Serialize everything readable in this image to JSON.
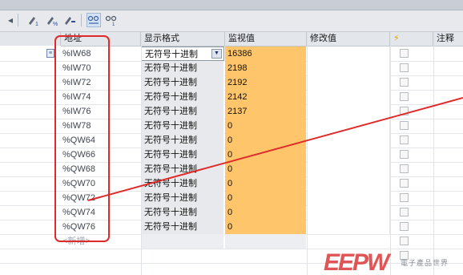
{
  "table": {
    "headers": [
      "地址",
      "显示格式",
      "监视值",
      "修改值",
      "注释"
    ],
    "rows": [
      {
        "address": "%IW68",
        "format": "无符号十进制",
        "monitor": "16386",
        "selected": true
      },
      {
        "address": "%IW70",
        "format": "无符号十进制",
        "monitor": "2198"
      },
      {
        "address": "%IW72",
        "format": "无符号十进制",
        "monitor": "2192"
      },
      {
        "address": "%IW74",
        "format": "无符号十进制",
        "monitor": "2142"
      },
      {
        "address": "%IW76",
        "format": "无符号十进制",
        "monitor": "2137"
      },
      {
        "address": "%IW78",
        "format": "无符号十进制",
        "monitor": "0"
      },
      {
        "address": "%QW64",
        "format": "无符号十进制",
        "monitor": "0"
      },
      {
        "address": "%QW66",
        "format": "无符号十进制",
        "monitor": "0"
      },
      {
        "address": "%QW68",
        "format": "无符号十进制",
        "monitor": "0"
      },
      {
        "address": "%QW70",
        "format": "无符号十进制",
        "monitor": "0"
      },
      {
        "address": "%QW72",
        "format": "无符号十进制",
        "monitor": "0"
      },
      {
        "address": "%QW74",
        "format": "无符号十进制",
        "monitor": "0"
      },
      {
        "address": "%QW76",
        "format": "无符号十进制",
        "monitor": "0"
      }
    ],
    "add_new_label": "<新增>"
  },
  "watermark": {
    "brand": "EEPW",
    "subtitle": "電子產品世界"
  },
  "colors": {
    "monitor_cell": "#fec56b",
    "annotation": "#e02a2a"
  }
}
